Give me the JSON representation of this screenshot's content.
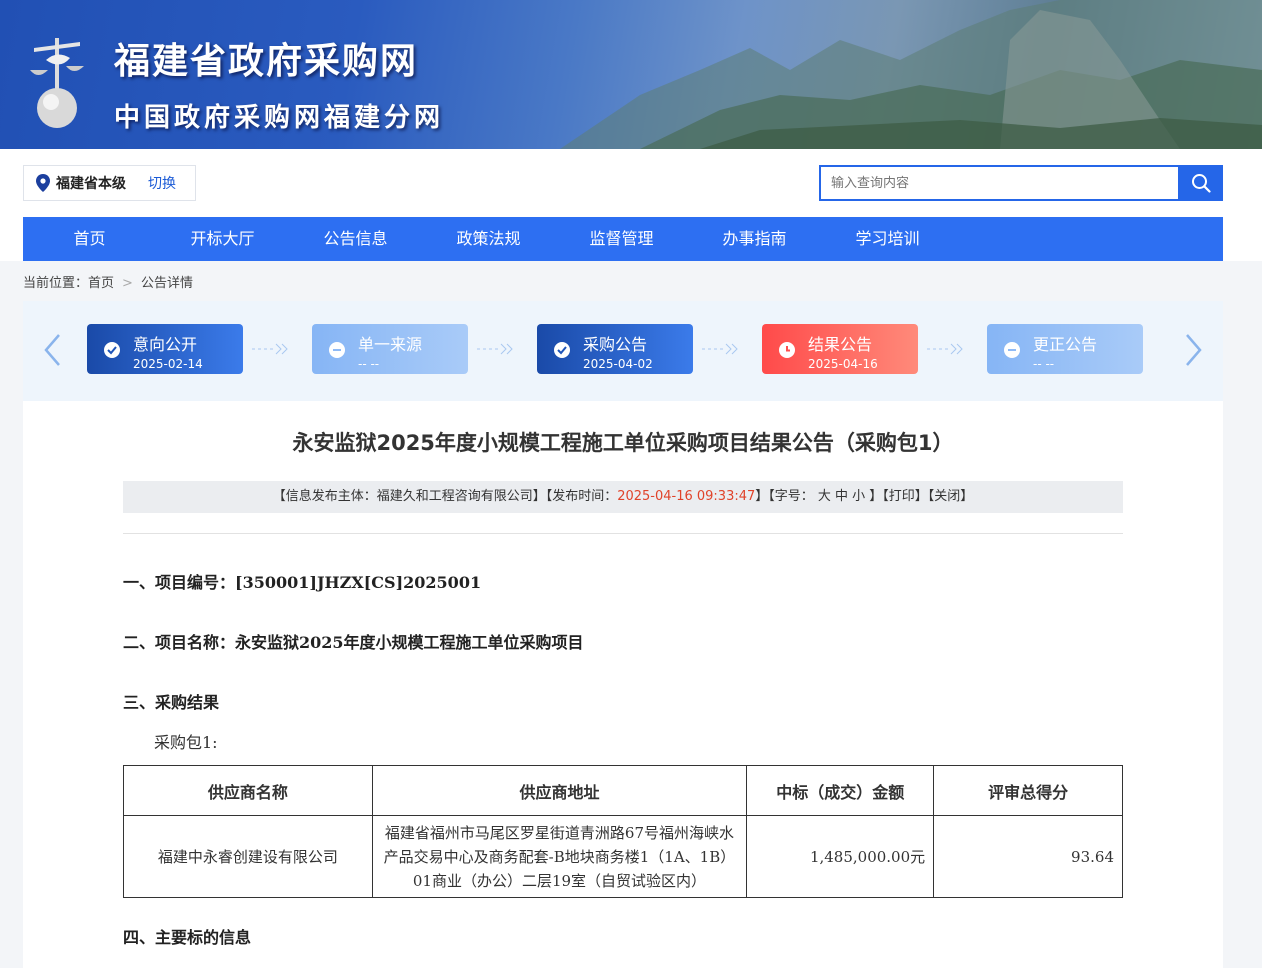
{
  "header": {
    "title": "福建省政府采购网",
    "subtitle": "中国政府采购网福建分网"
  },
  "region": {
    "name": "福建省本级",
    "switch_label": "切换"
  },
  "search": {
    "placeholder": "输入查询内容"
  },
  "nav": [
    "首页",
    "开标大厅",
    "公告信息",
    "政策法规",
    "监督管理",
    "办事指南",
    "学习培训"
  ],
  "breadcrumb": {
    "prefix": "当前位置：",
    "home": "首页",
    "current": "公告详情"
  },
  "timeline": [
    {
      "label": "意向公开",
      "date": "2025-02-14",
      "state": "done",
      "color": "#1e54b8"
    },
    {
      "label": "单一来源",
      "date": "-- --",
      "state": "none",
      "color": "#8fbaf6"
    },
    {
      "label": "采购公告",
      "date": "2025-04-02",
      "state": "done",
      "color": "#1e54b8"
    },
    {
      "label": "结果公告",
      "date": "2025-04-16",
      "state": "current",
      "color": "#ff4f4f"
    },
    {
      "label": "更正公告",
      "date": "-- --",
      "state": "none",
      "color": "#8fbaf6"
    }
  ],
  "article": {
    "title": "永安监狱2025年度小规模工程施工单位采购项目结果公告（采购包1）",
    "meta": {
      "publisher": "【信息发布主体：福建久和工程咨询有限公司】【发布时间：",
      "time": "2025-04-16 09:33:47",
      "font": "】【字号： 大 中 小 】【打印】【关闭】"
    },
    "sections": [
      "一、项目编号：[350001]JHZX[CS]2025001",
      "二、项目名称：永安监狱2025年度小规模工程施工单位采购项目",
      "三、采购结果",
      "四、主要标的信息"
    ],
    "package_label": "采购包1:",
    "table": {
      "headers": [
        "供应商名称",
        "供应商地址",
        "中标（成交）金额",
        "评审总得分"
      ],
      "rows": [
        {
          "name": "福建中永睿创建设有限公司",
          "address": "福建省福州市马尾区罗星街道青洲路67号福州海峡水产品交易中心及商务配套-B地块商务楼1（1A、1B）01商业（办公）二层19室（自贸试验区内）",
          "amount": "1,485,000.00元",
          "score": "93.64"
        }
      ]
    }
  },
  "colors": {
    "nav_bg": "#2d6ff2",
    "accent": "#2566e8",
    "time": "#e0432a"
  }
}
